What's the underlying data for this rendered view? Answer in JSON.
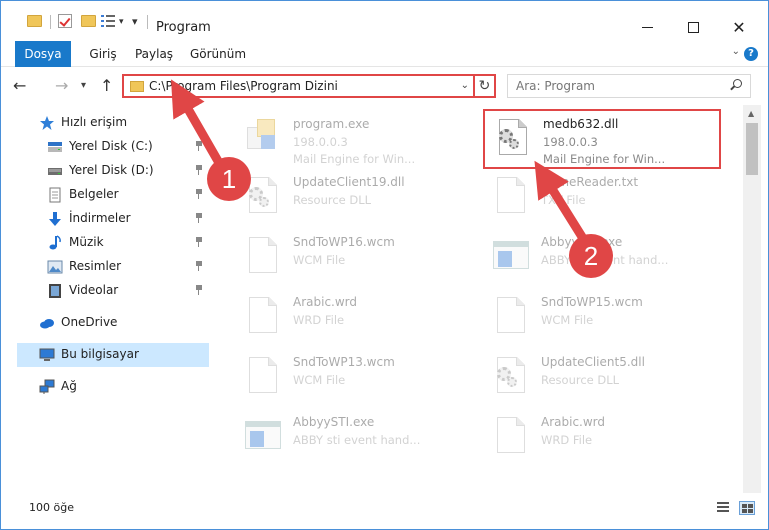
{
  "window": {
    "title": "Program"
  },
  "ribbon": {
    "tabs": [
      "Dosya",
      "Giriş",
      "Paylaş",
      "Görünüm"
    ],
    "help": "?"
  },
  "address": {
    "path": "C:\\Program Files\\Program Dizini"
  },
  "search": {
    "placeholder": "Ara: Program"
  },
  "nav": {
    "quick_access": "Hızlı erişim",
    "quick_items": [
      {
        "label": "Yerel Disk (C:)",
        "icon": "drive-icon"
      },
      {
        "label": "Yerel Disk (D:)",
        "icon": "drive-icon"
      },
      {
        "label": "Belgeler",
        "icon": "documents-icon"
      },
      {
        "label": "İndirmeler",
        "icon": "download-icon"
      },
      {
        "label": "Müzik",
        "icon": "music-icon"
      },
      {
        "label": "Resimler",
        "icon": "pictures-icon"
      },
      {
        "label": "Videolar",
        "icon": "videos-icon"
      }
    ],
    "onedrive": "OneDrive",
    "this_pc": "Bu bilgisayar",
    "network": "Ağ"
  },
  "files": [
    {
      "name": "program.exe",
      "line1": "198.0.0.3",
      "line2": "Mail Engine for Win...",
      "icon": "exe-app-icon",
      "faded": true
    },
    {
      "name": "medb632.dll",
      "line1": "198.0.0.3",
      "line2": "Mail Engine for Win...",
      "icon": "dll-icon",
      "faded": false,
      "highlight": true
    },
    {
      "name": "UpdateClient19.dll",
      "line1": "Resource DLL",
      "line2": "",
      "icon": "dll-icon",
      "faded": true
    },
    {
      "name": "NameReader.txt",
      "line1": "TXT File",
      "line2": "",
      "icon": "text-file-icon",
      "faded": true
    },
    {
      "name": "SndToWP16.wcm",
      "line1": "WCM File",
      "line2": "",
      "icon": "file-icon",
      "faded": true
    },
    {
      "name": "AbbyySTI.exe",
      "line1": "ABBY sti event hand...",
      "line2": "",
      "icon": "exe-window-icon",
      "faded": true
    },
    {
      "name": "Arabic.wrd",
      "line1": "WRD File",
      "line2": "",
      "icon": "file-icon",
      "faded": true
    },
    {
      "name": "SndToWP15.wcm",
      "line1": "WCM File",
      "line2": "",
      "icon": "file-icon",
      "faded": true
    },
    {
      "name": "SndToWP13.wcm",
      "line1": "WCM File",
      "line2": "",
      "icon": "file-icon",
      "faded": true
    },
    {
      "name": "UpdateClient5.dll",
      "line1": "Resource DLL",
      "line2": "",
      "icon": "dll-icon",
      "faded": true
    },
    {
      "name": "AbbyySTI.exe",
      "line1": "ABBY sti event hand...",
      "line2": "",
      "icon": "exe-window-icon",
      "faded": true
    },
    {
      "name": "Arabic.wrd",
      "line1": "WRD File",
      "line2": "",
      "icon": "file-icon",
      "faded": true
    }
  ],
  "status": {
    "count": "100 öğe"
  },
  "annotations": {
    "step1": "1",
    "step2": "2",
    "color": "#e04646"
  },
  "colors": {
    "accent": "#1979ca",
    "selection": "#cce8ff",
    "highlight": "#e04646"
  }
}
